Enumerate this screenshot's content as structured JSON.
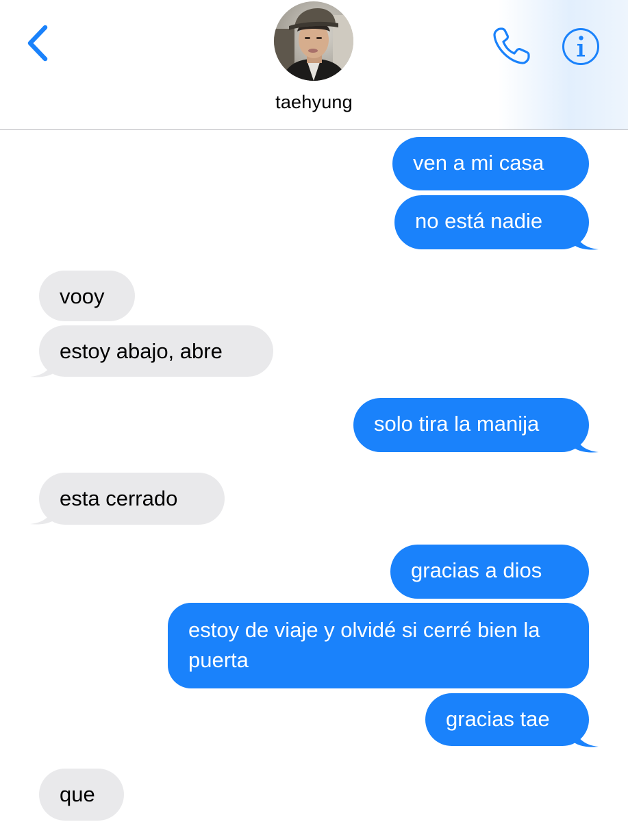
{
  "header": {
    "contact_name": "taehyung"
  },
  "colors": {
    "sent_bubble": "#1a82fb",
    "received_bubble": "#e9e9eb",
    "accent": "#1a82fb"
  },
  "icons": {
    "back": "chevron-left-icon",
    "call": "phone-icon",
    "info": "info-icon"
  },
  "messages": [
    {
      "from": "me",
      "text": "ven a mi casa"
    },
    {
      "from": "me",
      "text": "no está nadie"
    },
    {
      "from": "contact",
      "text": "vooy"
    },
    {
      "from": "contact",
      "text": "estoy abajo, abre"
    },
    {
      "from": "me",
      "text": "solo tira la manija"
    },
    {
      "from": "contact",
      "text": "esta cerrado"
    },
    {
      "from": "me",
      "text": "gracias a dios"
    },
    {
      "from": "me",
      "text": "estoy de viaje y olvidé si cerré bien la puerta"
    },
    {
      "from": "me",
      "text": "gracias tae"
    },
    {
      "from": "contact",
      "text": "que"
    }
  ]
}
